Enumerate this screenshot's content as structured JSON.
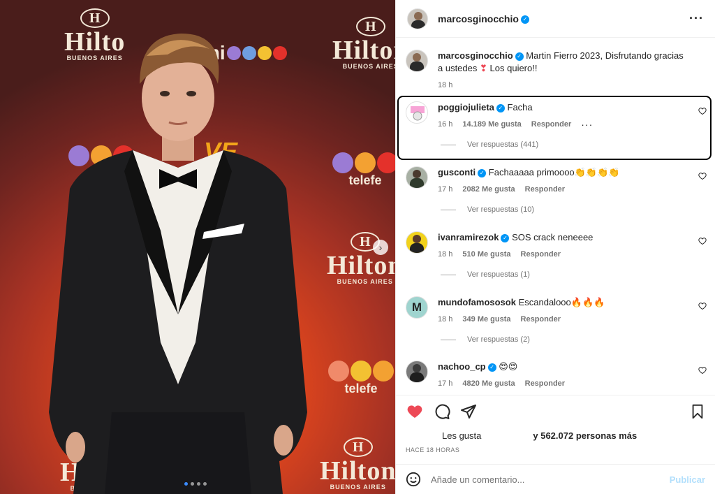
{
  "photo": {
    "brand_hilton": "Hilton",
    "brand_hilton_partial": "Hilto",
    "brand_hilton_sub": "BUENOS AIRES",
    "brand_telefe": "telefe",
    "brand_mi": "mi",
    "brand_ve": "VE",
    "colors": {
      "telefe_purple": "#9b7bd4",
      "telefe_orange": "#f3a132",
      "telefe_red": "#e4312b"
    }
  },
  "header": {
    "username": "marcosginocchio",
    "more_icon": "more-horizontal-icon"
  },
  "caption": {
    "username": "marcosginocchio",
    "text": "Martin Fierro 2023, Disfrutando gracias a ustedes",
    "text_end": "Los quiero!!",
    "time": "18 h"
  },
  "comments": [
    {
      "username": "poggiojulieta",
      "text": "Facha",
      "time": "16 h",
      "likes": "14.189 Me gusta",
      "reply": "Responder",
      "view_replies": "Ver respuestas (441)"
    },
    {
      "username": "gusconti",
      "text": "Fachaaaaa primoooo👏👏👏👏",
      "time": "17 h",
      "likes": "2082 Me gusta",
      "reply": "Responder",
      "view_replies": "Ver respuestas (10)"
    },
    {
      "username": "ivanramirezok",
      "text": "SOS crack neneeee",
      "time": "18 h",
      "likes": "510 Me gusta",
      "reply": "Responder",
      "view_replies": "Ver respuestas (1)"
    },
    {
      "username": "mundofamososok",
      "text": "Escandalooo🔥🔥🔥",
      "time": "18 h",
      "likes": "349 Me gusta",
      "reply": "Responder",
      "view_replies": "Ver respuestas (2)"
    },
    {
      "username": "nachoo_cp",
      "text": "😍😍",
      "time": "17 h",
      "likes": "4820 Me gusta",
      "reply": "Responder"
    }
  ],
  "actions": {
    "likes_label": "Les gusta",
    "likes_count": "y 562.072 personas más",
    "time_ago": "HACE 18 HORAS",
    "heart_color": "#ed4956"
  },
  "add_comment": {
    "placeholder": "Añade un comentario...",
    "publish": "Publicar"
  }
}
